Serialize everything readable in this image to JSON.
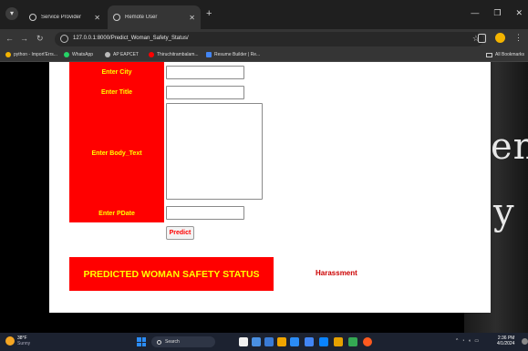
{
  "browser": {
    "tabs": [
      {
        "label": "Service Provider",
        "active": false
      },
      {
        "label": "Remote User",
        "active": true
      }
    ],
    "url": "127.0.0.1:8000/Predict_Woman_Safety_Status/",
    "bookmarks": [
      {
        "label": "python - Import'Errs...",
        "color": "#f4b400"
      },
      {
        "label": "WhatsApp",
        "color": "#25d366"
      },
      {
        "label": "AP EAPCET",
        "color": "#bbbbbb"
      },
      {
        "label": "Thiruchitrambalam...",
        "color": "#ff0000"
      },
      {
        "label": "Resume Builder | Re...",
        "color": "#4285f4"
      }
    ],
    "all_bookmarks": "All Bookmarks"
  },
  "background": {
    "text_1": "en",
    "text_2": "y"
  },
  "form": {
    "city_label": "Enter City",
    "city_value": "",
    "title_label": "Enter Title",
    "title_value": "",
    "body_label": "Enter Body_Text",
    "body_value": "",
    "pdate_label": "Enter PDate",
    "pdate_value": "",
    "predict_button": "Predict"
  },
  "result": {
    "heading": "PREDICTED WOMAN SAFETY STATUS",
    "value": "Harassment"
  },
  "taskbar": {
    "temperature": "38°F",
    "weather_sub": "Sunny",
    "search_placeholder": "Search",
    "time": "2:36 PM",
    "date": "4/1/2024",
    "app_colors": [
      "#f0f0f0",
      "#4a90e2",
      "#3a7bd5",
      "#f0a500",
      "#2b8cf5",
      "#4285f4",
      "#0a84ff",
      "#e6a100",
      "#34a853",
      "#ff5a1f"
    ]
  }
}
